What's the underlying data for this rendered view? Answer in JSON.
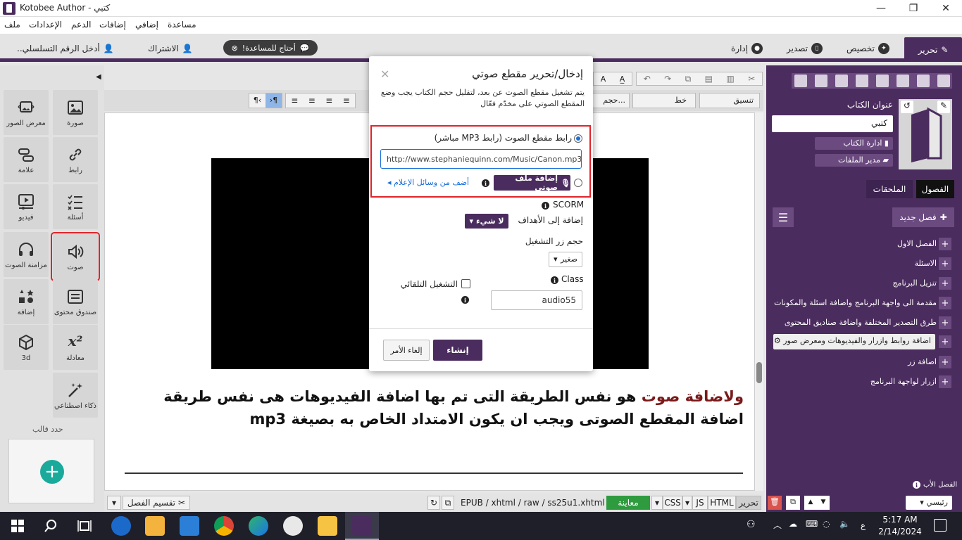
{
  "window": {
    "title": "Kotobee Author - كتبي",
    "minimize_glyph": "—",
    "maximize_glyph": "❐",
    "close_glyph": "✕"
  },
  "menu": [
    "ملف",
    "الإعدادات",
    "الدعم",
    "إضافات",
    "إضافي",
    "مساعدة"
  ],
  "top_tabs": {
    "edit": "تحرير",
    "customize": "تخصيص",
    "export": "تصدير",
    "manage": "إدارة"
  },
  "top_left": {
    "help": "أحتاج للمساعدة!",
    "subscribe": "الاشتراك",
    "serial": "أدخل الرقم التسلسلي.."
  },
  "tools": [
    {
      "id": "image",
      "label": "صورة",
      "icon": "image-icon"
    },
    {
      "id": "gallery",
      "label": "معرض الصور",
      "icon": "gallery-icon"
    },
    {
      "id": "link",
      "label": "رابط",
      "icon": "link-icon"
    },
    {
      "id": "marker",
      "label": "علامة",
      "icon": "marker-icon"
    },
    {
      "id": "questions",
      "label": "أسئلة",
      "icon": "questions-icon"
    },
    {
      "id": "video",
      "label": "فيديو",
      "icon": "video-icon"
    },
    {
      "id": "audio",
      "label": "صوت",
      "icon": "speaker-icon"
    },
    {
      "id": "audio-sync",
      "label": "مزامنة الصوت",
      "icon": "headphones-icon"
    },
    {
      "id": "content-box",
      "label": "صندوق محتوى",
      "icon": "content-box-icon"
    },
    {
      "id": "add",
      "label": "إضافة",
      "icon": "shapes-icon"
    },
    {
      "id": "equation",
      "label": "معادلة",
      "icon": "equation-icon"
    },
    {
      "id": "3d",
      "label": "3d",
      "icon": "cube-icon"
    },
    {
      "id": "ai",
      "label": "ذكاء اصطناعي",
      "icon": "magic-wand-icon"
    }
  ],
  "template": {
    "label": "حدد قالب",
    "add_glyph": "+"
  },
  "editor_toolbar": {
    "font_label": "خط",
    "size_label": "حجم...",
    "format_label": "تنسيق",
    "collapse_glyph": "◀",
    "expand_glyph": "▶"
  },
  "body_text": {
    "highlight": "ولاضافة صوت",
    "rest": " هو نفس الطريقة التى تم بها اضافة الفيديوهات هى نفس طريقة اضافة المقطع الصوتى ويجب ان يكون الامتداد الخاص به بصيغة mp3"
  },
  "bottom": {
    "split": "تقسيم الفصل",
    "path": "EPUB / xhtml / raw / ss25u1.xhtml",
    "preview": "معاينة",
    "css": "CSS",
    "js": "JS",
    "html": "HTML",
    "edit": "تحرير"
  },
  "right": {
    "book_title_label": "عنوان الكتاب",
    "book_title_value": "كتبي",
    "manage_book": "ادارة الكتاب",
    "file_manager": "مدير الملفات",
    "tab_chapters": "الفصول",
    "tab_attachments": "الملحقات",
    "new_chapter": "فصل جديد",
    "chapters": [
      "الفصل الاول",
      "الاسئلة",
      "تنزيل البرنامج",
      "مقدمة الى واجهة البرنامج واضافة اسئلة والمكونات",
      "طرق التصدير المختلفة واضافة صناديق المحتوى",
      "اضافة روابط وازرار والفيديوهات ومعرض صور",
      "اضافة زر",
      "ازرار لواجهة البرنامج"
    ],
    "parent_chapter_label": "الفصل الأب",
    "parent_chapter_value": "رئيسي"
  },
  "dialog": {
    "title": "إدخال/تحرير مقطع صوتي",
    "close_glyph": "✕",
    "description": "يتم تشغيل مقطع الصوت عن بعد، لتقليل حجم الكتاب يجب وضع المقطع الصوتي على مخدّم فعّال",
    "url_option_label": "رابط مقطع الصوت (رابط MP3 مباشر)",
    "url_value": "http://www.stephaniequinn.com/Music/Canon.mp3",
    "add_audio_file": "إضافة ملف صوتي",
    "add_from_media": "أضف من وسائل الإعلام",
    "scorm_label": "SCORM",
    "add_to_goals_label": "إضافة إلى الأهداف",
    "goals_value": "لا شيء",
    "button_size_label": "حجم زر التشغيل",
    "button_size_value": "صغير",
    "class_label": "Class",
    "class_value": "audio55",
    "autoplay_label": "التشغيل التلقائي",
    "autoplay_checked": false,
    "create": "إنشاء",
    "cancel": "إلغاء الأمر"
  },
  "taskbar": {
    "time": "5:17 AM",
    "date": "2/14/2024",
    "lang": "ع"
  }
}
